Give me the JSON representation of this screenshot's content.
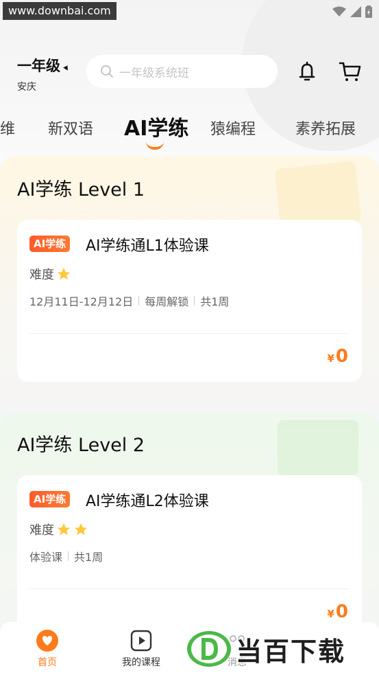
{
  "status_bar": {
    "watermark": "www.downbai.com"
  },
  "header": {
    "grade": "一年级",
    "city": "安庆",
    "search_placeholder": "一年级系统班"
  },
  "tabs": [
    {
      "label": "维"
    },
    {
      "label": "新双语"
    },
    {
      "label": "AI学练",
      "active": true
    },
    {
      "label": "猿编程"
    },
    {
      "label": "素养拓展"
    }
  ],
  "sections": [
    {
      "title": "AI学练 Level 1",
      "card": {
        "tag": "AI学练",
        "title": "AI学练通L1体验课",
        "difficulty_label": "难度",
        "difficulty_stars": 1,
        "meta": [
          "12月11日-12月12日",
          "每周解锁",
          "共1周"
        ],
        "price_symbol": "¥",
        "price": "0"
      }
    },
    {
      "title": "AI学练 Level 2",
      "card": {
        "tag": "AI学练",
        "title": "AI学练通L2体验课",
        "difficulty_label": "难度",
        "difficulty_stars": 2,
        "meta": [
          "体验课",
          "共1周"
        ],
        "price_symbol": "¥",
        "price": "0"
      }
    }
  ],
  "bottom_nav": [
    {
      "label": "首页",
      "active": true
    },
    {
      "label": "我的课程"
    },
    {
      "label": "消息"
    }
  ],
  "brand_watermark": "当百下载",
  "colors": {
    "accent": "#ff7a1a",
    "tag_start": "#ff5a2a",
    "star": "#ffc83a"
  }
}
